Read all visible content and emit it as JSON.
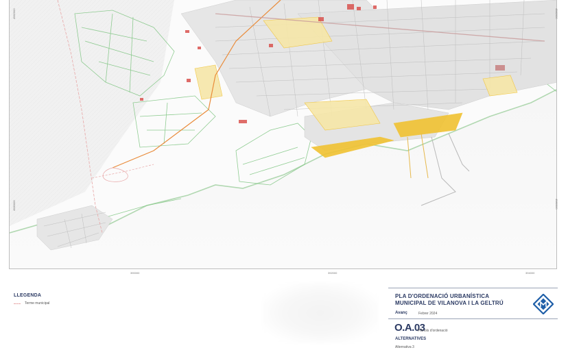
{
  "map": {
    "coords_left": [
      "4582000",
      "4580000"
    ],
    "coords_right": [
      "4582000",
      "4580000"
    ],
    "coords_bottom": [
      "390000",
      "392000",
      "394000"
    ]
  },
  "legend": {
    "title": "LLEGENDA",
    "items": [
      {
        "label": "Terme municipal",
        "color": "#e8a6a6",
        "style": "dashed"
      }
    ]
  },
  "title_block": {
    "plan_title_line1": "PLA D'ORDENACIÓ URBANÍSTICA",
    "plan_title_line2": "MUNICIPAL DE VILANOVA I LA GELTRÚ",
    "phase": "Avanç",
    "date": "Febrer 2024",
    "plan_code": "O.A.03",
    "plan_name": "Plànols d'ordenació",
    "section": "ALTERNATIVES",
    "alternative": "Alternativa 3"
  },
  "colors": {
    "brand": "#2b3a63",
    "logo": "#1f5fa8",
    "vegetation": "#6fbf73",
    "urban_yellow": "#f1c232",
    "built": "#c8c8c8",
    "facility_red": "#d9534f",
    "boundary": "#e8a6a6"
  }
}
